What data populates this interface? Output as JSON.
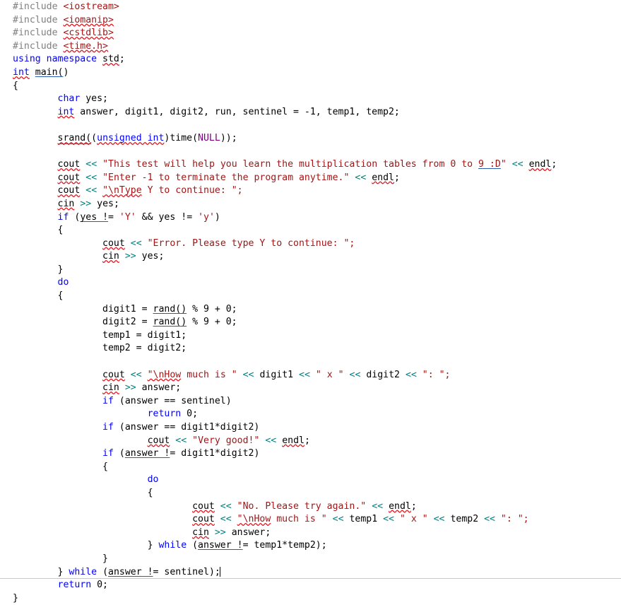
{
  "document": {
    "kind": "source-code-listing",
    "language": "C++",
    "caret_after": "} while (answer != sentinel);",
    "colors": {
      "background": "#ffffff",
      "plain_text": "#000000",
      "keyword": "#0000ff",
      "preprocessor": "#808080",
      "string": "#a31515",
      "stream_operator": "#008080",
      "macro": "#800080",
      "spelling_squiggle": "#e01b24",
      "grammar_underline": "#2a5db0",
      "page_border": "#c8c8c8"
    }
  },
  "code": {
    "lines": [
      [
        {
          "t": "#include ",
          "c": "pp"
        },
        {
          "t": "<iostream>",
          "c": "str"
        }
      ],
      [
        {
          "t": "#include ",
          "c": "pp"
        },
        {
          "t": "<iomanip>",
          "c": "str",
          "m": "sp"
        }
      ],
      [
        {
          "t": "#include ",
          "c": "pp"
        },
        {
          "t": "<cstdlib>",
          "c": "str",
          "m": "sp"
        }
      ],
      [
        {
          "t": "#include ",
          "c": "pp"
        },
        {
          "t": "<time.h>",
          "c": "str",
          "m": "sp"
        }
      ],
      [
        {
          "t": "using namespace ",
          "c": "kw"
        },
        {
          "t": "std",
          "c": "pl",
          "m": "sp"
        },
        {
          "t": ";",
          "c": "pl"
        }
      ],
      [
        {
          "t": "int",
          "c": "kw",
          "m": "sp"
        },
        {
          "t": " ",
          "c": "pl"
        },
        {
          "t": "main(",
          "c": "pl",
          "m": "gr"
        },
        {
          "t": ")",
          "c": "pl"
        }
      ],
      [
        {
          "t": "{",
          "c": "pl"
        }
      ],
      [
        {
          "t": "        ",
          "c": "pl"
        },
        {
          "t": "char",
          "c": "kw"
        },
        {
          "t": " yes;",
          "c": "pl"
        }
      ],
      [
        {
          "t": "        ",
          "c": "pl"
        },
        {
          "t": "int",
          "c": "kw",
          "m": "sp"
        },
        {
          "t": " answer, digit1, digit2, run, sentinel = -1, temp1, temp2;",
          "c": "pl"
        }
      ],
      [
        {
          "t": "",
          "c": "pl"
        }
      ],
      [
        {
          "t": "        ",
          "c": "pl"
        },
        {
          "t": "srand(",
          "c": "pl",
          "m": "spgr"
        },
        {
          "t": "(",
          "c": "pl"
        },
        {
          "t": "unsigned int",
          "c": "kw",
          "m": "sp"
        },
        {
          "t": ")time(",
          "c": "pl"
        },
        {
          "t": "NULL",
          "c": "mac"
        },
        {
          "t": "));",
          "c": "pl"
        }
      ],
      [
        {
          "t": "",
          "c": "pl"
        }
      ],
      [
        {
          "t": "        ",
          "c": "pl"
        },
        {
          "t": "cout",
          "c": "pl",
          "m": "sp"
        },
        {
          "t": " ",
          "c": "pl"
        },
        {
          "t": "<<",
          "c": "op"
        },
        {
          "t": " ",
          "c": "pl"
        },
        {
          "t": "\"This test will help you learn the multiplication tables from 0 to ",
          "c": "str"
        },
        {
          "t": "9 :D",
          "c": "str",
          "m": "gr"
        },
        {
          "t": "\"",
          "c": "str"
        },
        {
          "t": " ",
          "c": "pl"
        },
        {
          "t": "<<",
          "c": "op"
        },
        {
          "t": " ",
          "c": "pl"
        },
        {
          "t": "endl",
          "c": "pl",
          "m": "sp"
        },
        {
          "t": ";",
          "c": "pl"
        }
      ],
      [
        {
          "t": "        ",
          "c": "pl"
        },
        {
          "t": "cout",
          "c": "pl",
          "m": "sp"
        },
        {
          "t": " ",
          "c": "pl"
        },
        {
          "t": "<<",
          "c": "op"
        },
        {
          "t": " ",
          "c": "pl"
        },
        {
          "t": "\"Enter -1 to terminate the program anytime.\"",
          "c": "str"
        },
        {
          "t": " ",
          "c": "pl"
        },
        {
          "t": "<<",
          "c": "op"
        },
        {
          "t": " ",
          "c": "pl"
        },
        {
          "t": "endl",
          "c": "pl",
          "m": "sp"
        },
        {
          "t": ";",
          "c": "pl"
        }
      ],
      [
        {
          "t": "        ",
          "c": "pl"
        },
        {
          "t": "cout",
          "c": "pl",
          "m": "sp"
        },
        {
          "t": " ",
          "c": "pl"
        },
        {
          "t": "<<",
          "c": "op"
        },
        {
          "t": " ",
          "c": "pl"
        },
        {
          "t": "\"\\nType",
          "c": "str",
          "m": "sp"
        },
        {
          "t": " Y to continue: \";",
          "c": "str"
        }
      ],
      [
        {
          "t": "        ",
          "c": "pl"
        },
        {
          "t": "cin",
          "c": "pl",
          "m": "sp"
        },
        {
          "t": " ",
          "c": "pl"
        },
        {
          "t": ">>",
          "c": "op"
        },
        {
          "t": " yes;",
          "c": "pl"
        }
      ],
      [
        {
          "t": "        ",
          "c": "pl"
        },
        {
          "t": "if",
          "c": "kw"
        },
        {
          "t": " (",
          "c": "pl"
        },
        {
          "t": "yes !",
          "c": "pl",
          "m": "gr"
        },
        {
          "t": "= ",
          "c": "pl"
        },
        {
          "t": "'Y'",
          "c": "str"
        },
        {
          "t": " && yes != ",
          "c": "pl"
        },
        {
          "t": "'y'",
          "c": "str"
        },
        {
          "t": ")",
          "c": "pl"
        }
      ],
      [
        {
          "t": "        ",
          "c": "pl"
        },
        {
          "t": "{",
          "c": "pl"
        }
      ],
      [
        {
          "t": "                ",
          "c": "pl"
        },
        {
          "t": "cout",
          "c": "pl",
          "m": "sp"
        },
        {
          "t": " ",
          "c": "pl"
        },
        {
          "t": "<<",
          "c": "op"
        },
        {
          "t": " ",
          "c": "pl"
        },
        {
          "t": "\"Error. Please type Y to continue: \";",
          "c": "str"
        }
      ],
      [
        {
          "t": "                ",
          "c": "pl"
        },
        {
          "t": "cin",
          "c": "pl",
          "m": "sp"
        },
        {
          "t": " ",
          "c": "pl"
        },
        {
          "t": ">>",
          "c": "op"
        },
        {
          "t": " yes;",
          "c": "pl"
        }
      ],
      [
        {
          "t": "        ",
          "c": "pl"
        },
        {
          "t": "}",
          "c": "pl"
        }
      ],
      [
        {
          "t": "        ",
          "c": "pl"
        },
        {
          "t": "do",
          "c": "kw"
        }
      ],
      [
        {
          "t": "        ",
          "c": "pl"
        },
        {
          "t": "{",
          "c": "pl"
        }
      ],
      [
        {
          "t": "                ",
          "c": "pl"
        },
        {
          "t": "digit1 = ",
          "c": "pl"
        },
        {
          "t": "rand()",
          "c": "pl",
          "m": "gr"
        },
        {
          "t": " % 9 + 0;",
          "c": "pl"
        }
      ],
      [
        {
          "t": "                ",
          "c": "pl"
        },
        {
          "t": "digit2 = ",
          "c": "pl"
        },
        {
          "t": "rand()",
          "c": "pl",
          "m": "gr"
        },
        {
          "t": " % 9 + 0;",
          "c": "pl"
        }
      ],
      [
        {
          "t": "                ",
          "c": "pl"
        },
        {
          "t": "temp1 = digit1;",
          "c": "pl"
        }
      ],
      [
        {
          "t": "                ",
          "c": "pl"
        },
        {
          "t": "temp2 = digit2;",
          "c": "pl"
        }
      ],
      [
        {
          "t": "",
          "c": "pl"
        }
      ],
      [
        {
          "t": "                ",
          "c": "pl"
        },
        {
          "t": "cout",
          "c": "pl",
          "m": "sp"
        },
        {
          "t": " ",
          "c": "pl"
        },
        {
          "t": "<<",
          "c": "op"
        },
        {
          "t": " ",
          "c": "pl"
        },
        {
          "t": "\"\\nHow",
          "c": "str",
          "m": "sp"
        },
        {
          "t": " much is \"",
          "c": "str"
        },
        {
          "t": " ",
          "c": "pl"
        },
        {
          "t": "<<",
          "c": "op"
        },
        {
          "t": " digit1 ",
          "c": "pl"
        },
        {
          "t": "<<",
          "c": "op"
        },
        {
          "t": " ",
          "c": "pl"
        },
        {
          "t": "\" x \"",
          "c": "str"
        },
        {
          "t": " ",
          "c": "pl"
        },
        {
          "t": "<<",
          "c": "op"
        },
        {
          "t": " digit2 ",
          "c": "pl"
        },
        {
          "t": "<<",
          "c": "op"
        },
        {
          "t": " ",
          "c": "pl"
        },
        {
          "t": "\": \";",
          "c": "str"
        }
      ],
      [
        {
          "t": "                ",
          "c": "pl"
        },
        {
          "t": "cin",
          "c": "pl",
          "m": "sp"
        },
        {
          "t": " ",
          "c": "pl"
        },
        {
          "t": ">>",
          "c": "op"
        },
        {
          "t": " answer;",
          "c": "pl"
        }
      ],
      [
        {
          "t": "                ",
          "c": "pl"
        },
        {
          "t": "if",
          "c": "kw"
        },
        {
          "t": " (answer == sentinel)",
          "c": "pl"
        }
      ],
      [
        {
          "t": "                        ",
          "c": "pl"
        },
        {
          "t": "return",
          "c": "kw"
        },
        {
          "t": " 0;",
          "c": "pl"
        }
      ],
      [
        {
          "t": "                ",
          "c": "pl"
        },
        {
          "t": "if",
          "c": "kw"
        },
        {
          "t": " (answer == digit1*digit2)",
          "c": "pl"
        }
      ],
      [
        {
          "t": "                        ",
          "c": "pl"
        },
        {
          "t": "cout",
          "c": "pl",
          "m": "sp"
        },
        {
          "t": " ",
          "c": "pl"
        },
        {
          "t": "<<",
          "c": "op"
        },
        {
          "t": " ",
          "c": "pl"
        },
        {
          "t": "\"Very good!\"",
          "c": "str"
        },
        {
          "t": " ",
          "c": "pl"
        },
        {
          "t": "<<",
          "c": "op"
        },
        {
          "t": " ",
          "c": "pl"
        },
        {
          "t": "endl",
          "c": "pl",
          "m": "sp"
        },
        {
          "t": ";",
          "c": "pl"
        }
      ],
      [
        {
          "t": "                ",
          "c": "pl"
        },
        {
          "t": "if",
          "c": "kw"
        },
        {
          "t": " (",
          "c": "pl"
        },
        {
          "t": "answer !",
          "c": "pl",
          "m": "gr"
        },
        {
          "t": "= digit1*digit2)",
          "c": "pl"
        }
      ],
      [
        {
          "t": "                ",
          "c": "pl"
        },
        {
          "t": "{",
          "c": "pl"
        }
      ],
      [
        {
          "t": "                        ",
          "c": "pl"
        },
        {
          "t": "do",
          "c": "kw"
        }
      ],
      [
        {
          "t": "                        ",
          "c": "pl"
        },
        {
          "t": "{",
          "c": "pl"
        }
      ],
      [
        {
          "t": "                                ",
          "c": "pl"
        },
        {
          "t": "cout",
          "c": "pl",
          "m": "sp"
        },
        {
          "t": " ",
          "c": "pl"
        },
        {
          "t": "<<",
          "c": "op"
        },
        {
          "t": " ",
          "c": "pl"
        },
        {
          "t": "\"No. Please try again.\"",
          "c": "str"
        },
        {
          "t": " ",
          "c": "pl"
        },
        {
          "t": "<<",
          "c": "op"
        },
        {
          "t": " ",
          "c": "pl"
        },
        {
          "t": "endl",
          "c": "pl",
          "m": "sp"
        },
        {
          "t": ";",
          "c": "pl"
        }
      ],
      [
        {
          "t": "                                ",
          "c": "pl"
        },
        {
          "t": "cout",
          "c": "pl",
          "m": "sp"
        },
        {
          "t": " ",
          "c": "pl"
        },
        {
          "t": "<<",
          "c": "op"
        },
        {
          "t": " ",
          "c": "pl"
        },
        {
          "t": "\"\\nHow",
          "c": "str",
          "m": "sp"
        },
        {
          "t": " much is \"",
          "c": "str"
        },
        {
          "t": " ",
          "c": "pl"
        },
        {
          "t": "<<",
          "c": "op"
        },
        {
          "t": " temp1 ",
          "c": "pl"
        },
        {
          "t": "<<",
          "c": "op"
        },
        {
          "t": " ",
          "c": "pl"
        },
        {
          "t": "\" x \"",
          "c": "str"
        },
        {
          "t": " ",
          "c": "pl"
        },
        {
          "t": "<<",
          "c": "op"
        },
        {
          "t": " temp2 ",
          "c": "pl"
        },
        {
          "t": "<<",
          "c": "op"
        },
        {
          "t": " ",
          "c": "pl"
        },
        {
          "t": "\": \";",
          "c": "str"
        }
      ],
      [
        {
          "t": "                                ",
          "c": "pl"
        },
        {
          "t": "cin",
          "c": "pl",
          "m": "sp"
        },
        {
          "t": " ",
          "c": "pl"
        },
        {
          "t": ">>",
          "c": "op"
        },
        {
          "t": " answer;",
          "c": "pl"
        }
      ],
      [
        {
          "t": "                        ",
          "c": "pl"
        },
        {
          "t": "} ",
          "c": "pl"
        },
        {
          "t": "while",
          "c": "kw"
        },
        {
          "t": " (",
          "c": "pl"
        },
        {
          "t": "answer !",
          "c": "pl",
          "m": "gr"
        },
        {
          "t": "= temp1*temp2);",
          "c": "pl"
        }
      ],
      [
        {
          "t": "                ",
          "c": "pl"
        },
        {
          "t": "}",
          "c": "pl"
        }
      ],
      [
        {
          "t": "        ",
          "c": "pl"
        },
        {
          "t": "} ",
          "c": "pl"
        },
        {
          "t": "while",
          "c": "kw"
        },
        {
          "t": " (",
          "c": "pl"
        },
        {
          "t": "answer !",
          "c": "pl",
          "m": "gr"
        },
        {
          "t": "= sentinel);",
          "c": "pl"
        },
        {
          "t": "",
          "c": "pl",
          "caret": true
        }
      ],
      [
        {
          "t": "        ",
          "c": "pl"
        },
        {
          "t": "return",
          "c": "kw"
        },
        {
          "t": " 0;",
          "c": "pl"
        }
      ],
      [
        {
          "t": "}",
          "c": "pl"
        }
      ]
    ]
  }
}
